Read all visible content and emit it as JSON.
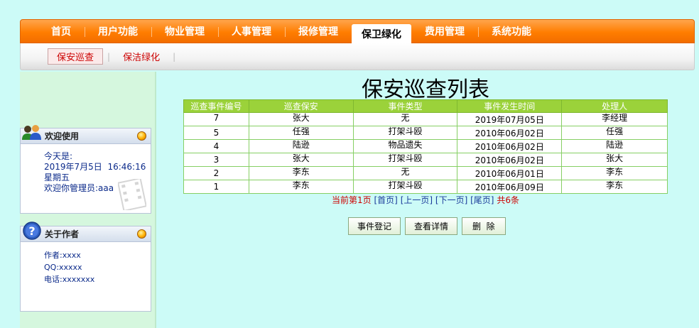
{
  "top_nav": {
    "items": [
      {
        "label": "首页",
        "active": false
      },
      {
        "label": "用户功能",
        "active": false
      },
      {
        "label": "物业管理",
        "active": false
      },
      {
        "label": "人事管理",
        "active": false
      },
      {
        "label": "报修管理",
        "active": false
      },
      {
        "label": "保卫绿化",
        "active": true
      },
      {
        "label": "费用管理",
        "active": false
      },
      {
        "label": "系统功能",
        "active": false
      }
    ]
  },
  "sub_nav": {
    "items": [
      {
        "label": "保安巡查",
        "active": true
      },
      {
        "label": "保洁绿化",
        "active": false
      }
    ]
  },
  "welcome_panel": {
    "title": "欢迎使用",
    "lines": [
      "今天是:",
      "2019年7月5日  16:46:16",
      "星期五",
      "欢迎你管理员:aaa"
    ]
  },
  "author_panel": {
    "title": "关于作者",
    "lines": [
      "作者:xxxx",
      "QQ:xxxxx",
      "电话:xxxxxxx"
    ]
  },
  "main": {
    "title": "保安巡查列表",
    "columns": [
      "巡查事件编号",
      "巡查保安",
      "事件类型",
      "事件发生时间",
      "处理人"
    ],
    "rows": [
      [
        "7",
        "张大",
        "无",
        "2019年07月05日",
        "李经理"
      ],
      [
        "5",
        "任强",
        "打架斗殴",
        "2010年06月02日",
        "任强"
      ],
      [
        "4",
        "陆逊",
        "物品遗失",
        "2010年06月02日",
        "陆逊"
      ],
      [
        "3",
        "张大",
        "打架斗殴",
        "2010年06月02日",
        "张大"
      ],
      [
        "2",
        "李东",
        "无",
        "2010年06月01日",
        "李东"
      ],
      [
        "1",
        "李东",
        "打架斗殴",
        "2010年06月09日",
        "李东"
      ]
    ],
    "pager": {
      "current": "当前第1页",
      "first": "[首页]",
      "prev": "[上一页]",
      "next": "[下一页]",
      "last": "[尾页]",
      "total": "共6条"
    },
    "buttons": {
      "register": "事件登记",
      "details": "查看详情",
      "delete": "删  除"
    }
  },
  "colors": {
    "nav_orange": "#ff7d00",
    "table_header": "#9bd23a",
    "page_bg": "#ccfbf7",
    "sidebar_bg": "#d5f7de"
  },
  "icons": {
    "welcome": "users-icon",
    "author": "help-icon",
    "panel_orb": "orb-icon"
  }
}
